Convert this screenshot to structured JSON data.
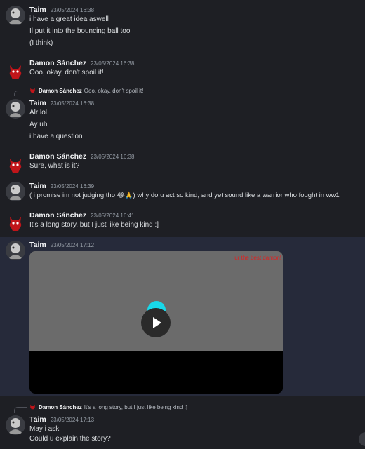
{
  "users": {
    "taim": "Taim",
    "damon": "Damon Sánchez"
  },
  "messages": [
    {
      "author": "Taim",
      "time": "23/05/2024 16:38",
      "lines": [
        "i have a great idea aswell",
        "Il put it into the bouncing ball too",
        "(I think)"
      ]
    },
    {
      "author": "Damon Sánchez",
      "time": "23/05/2024 16:38",
      "lines": [
        "Ooo, okay, don't spoil it!"
      ]
    },
    {
      "author": "Taim",
      "time": "23/05/2024 16:38",
      "reply": {
        "author": "Damon Sánchez",
        "text": "Ooo, okay, don't spoil it!"
      },
      "lines": [
        "Alr lol",
        "Ay uh",
        "i have a question"
      ]
    },
    {
      "author": "Damon Sánchez",
      "time": "23/05/2024 16:38",
      "lines": [
        "Sure, what is it?"
      ]
    },
    {
      "author": "Taim",
      "time": "23/05/2024 16:39",
      "lines": [
        "( i promise im not judging tho 😂🙏) why do u act so kind, and yet sound like a warrior who fought in ww1"
      ]
    },
    {
      "author": "Damon Sánchez",
      "time": "23/05/2024 16:41",
      "lines": [
        "It's a long story, but I just like being kind :]"
      ]
    },
    {
      "author": "Taim",
      "time": "23/05/2024 17:12",
      "video": {
        "caption": "ur the best damon!"
      }
    },
    {
      "author": "Taim",
      "time": "23/05/2024 17:13",
      "reply": {
        "author": "Damon Sánchez",
        "text": "It's a long story, but I just like being kind :]"
      },
      "lines": [
        "May i ask",
        "Could u explain the story?"
      ]
    }
  ],
  "icons": {
    "taim_avatar": "gray-character-avatar-icon",
    "damon_avatar": "red-demon-avatar-icon",
    "play": "play-icon"
  },
  "colors": {
    "background": "#1e1f24",
    "highlight": "#262a3a",
    "video_top": "#6b6b6b",
    "caption": "#e02020",
    "ball": "#18d9ea"
  }
}
